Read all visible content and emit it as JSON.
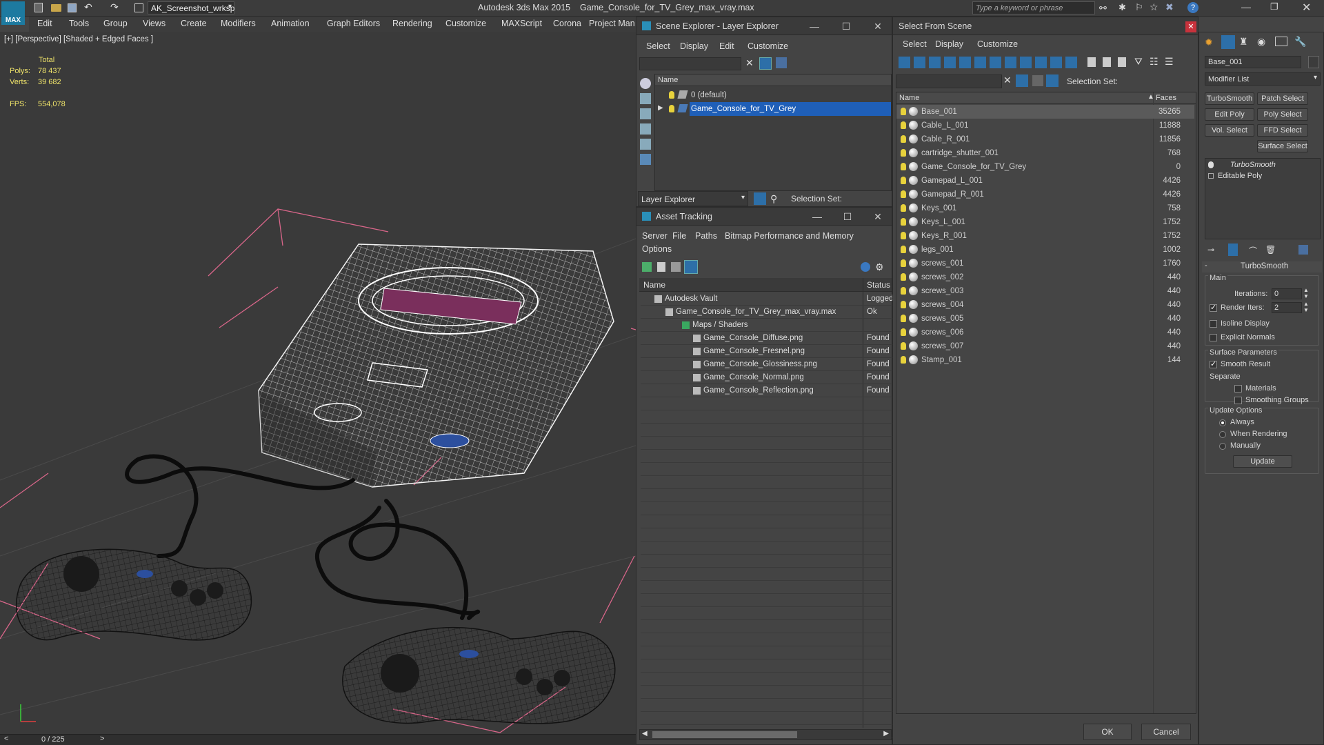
{
  "app": {
    "title": "Autodesk 3ds Max  2015",
    "file": "Game_Console_for_TV_Grey_max_vray.max",
    "workspace": "AK_Screenshot_wrksp",
    "search_placeholder": "Type a keyword or phrase"
  },
  "menubar": [
    "Edit",
    "Tools",
    "Group",
    "Views",
    "Create",
    "Modifiers",
    "Animation",
    "Graph Editors",
    "Rendering",
    "Customize",
    "MAXScript",
    "Corona",
    "Project Man"
  ],
  "viewport": {
    "label": "[+] [Perspective] [Shaded + Edged Faces ]",
    "stats_header": "Total",
    "polys_label": "Polys:",
    "polys": "78 437",
    "verts_label": "Verts:",
    "verts": "39 682",
    "fps_label": "FPS:",
    "fps": "554,078",
    "time": "0 / 225"
  },
  "scene_explorer": {
    "title": "Scene Explorer - Layer Explorer",
    "menu": [
      "Select",
      "Display",
      "Edit",
      "Customize"
    ],
    "col_name": "Name",
    "rows": [
      "0 (default)",
      "Game_Console_for_TV_Grey"
    ],
    "footer": "Layer Explorer",
    "selection_set": "Selection Set:"
  },
  "asset_tracking": {
    "title": "Asset Tracking",
    "menu": [
      "Server",
      "File",
      "Paths",
      "Bitmap Performance and Memory",
      "Options"
    ],
    "col_name": "Name",
    "col_status": "Status",
    "rows": [
      {
        "name": "Autodesk Vault",
        "status": "Logged"
      },
      {
        "name": "Game_Console_for_TV_Grey_max_vray.max",
        "status": "Ok"
      },
      {
        "name": "Maps / Shaders",
        "status": ""
      },
      {
        "name": "Game_Console_Diffuse.png",
        "status": "Found"
      },
      {
        "name": "Game_Console_Fresnel.png",
        "status": "Found"
      },
      {
        "name": "Game_Console_Glossiness.png",
        "status": "Found"
      },
      {
        "name": "Game_Console_Normal.png",
        "status": "Found"
      },
      {
        "name": "Game_Console_Reflection.png",
        "status": "Found"
      }
    ]
  },
  "select_from_scene": {
    "title": "Select From Scene",
    "menu": [
      "Select",
      "Display",
      "Customize"
    ],
    "selection_set": "Selection Set:",
    "col_name": "Name",
    "col_faces": "Faces",
    "rows": [
      {
        "name": "Base_001",
        "faces": "35265"
      },
      {
        "name": "Cable_L_001",
        "faces": "11888"
      },
      {
        "name": "Cable_R_001",
        "faces": "11856"
      },
      {
        "name": "cartridge_shutter_001",
        "faces": "768"
      },
      {
        "name": "Game_Console_for_TV_Grey",
        "faces": "0"
      },
      {
        "name": "Gamepad_L_001",
        "faces": "4426"
      },
      {
        "name": "Gamepad_R_001",
        "faces": "4426"
      },
      {
        "name": "Keys_001",
        "faces": "758"
      },
      {
        "name": "Keys_L_001",
        "faces": "1752"
      },
      {
        "name": "Keys_R_001",
        "faces": "1752"
      },
      {
        "name": "legs_001",
        "faces": "1002"
      },
      {
        "name": "screws_001",
        "faces": "1760"
      },
      {
        "name": "screws_002",
        "faces": "440"
      },
      {
        "name": "screws_003",
        "faces": "440"
      },
      {
        "name": "screws_004",
        "faces": "440"
      },
      {
        "name": "screws_005",
        "faces": "440"
      },
      {
        "name": "screws_006",
        "faces": "440"
      },
      {
        "name": "screws_007",
        "faces": "440"
      },
      {
        "name": "Stamp_001",
        "faces": "144"
      }
    ],
    "ok": "OK",
    "cancel": "Cancel"
  },
  "command_panel": {
    "object_name": "Base_001",
    "modifier_list": "Modifier List",
    "buttons": [
      "TurboSmooth",
      "Patch Select",
      "Edit Poly",
      "Poly Select",
      "Vol. Select",
      "FFD Select",
      "Surface Select"
    ],
    "stack": [
      "TurboSmooth",
      "Editable Poly"
    ],
    "rollout": "TurboSmooth",
    "main": "Main",
    "iterations_label": "Iterations:",
    "iterations": "0",
    "render_iters_label": "Render Iters:",
    "render_iters": "2",
    "isoline": "Isoline Display",
    "explicit_normals": "Explicit Normals",
    "surface_params": "Surface Parameters",
    "smooth_result": "Smooth Result",
    "separate": "Separate",
    "materials": "Materials",
    "smoothing_groups": "Smoothing Groups",
    "update_options": "Update Options",
    "always": "Always",
    "when_rendering": "When Rendering",
    "manually": "Manually",
    "update": "Update"
  },
  "colors": {
    "selection": "#1f5fb8",
    "accent": "#2a8fb8",
    "bulb": "#e8d23c"
  }
}
